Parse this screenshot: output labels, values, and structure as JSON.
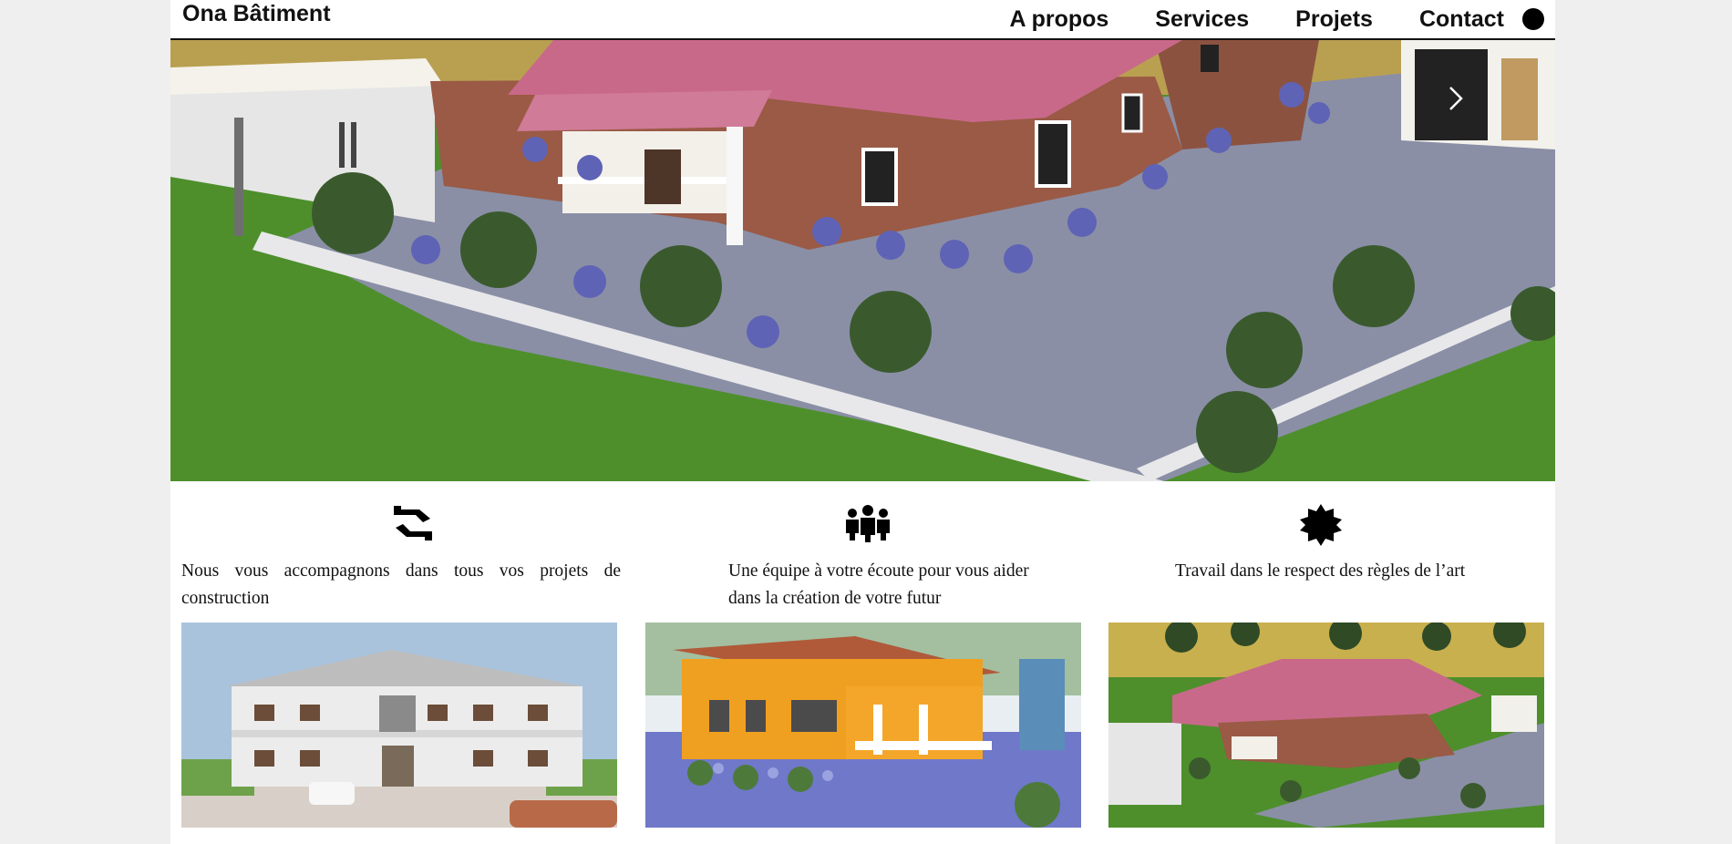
{
  "brand": "Ona Bâtiment",
  "nav": {
    "about": "A propos",
    "services": "Services",
    "projects": "Projets",
    "contact": "Contact"
  },
  "hero": {
    "image": "rendering of single-storey brick house with pink roof",
    "next_icon": "chevron-right-icon"
  },
  "features": [
    {
      "icon": "handshake-icon",
      "text": "Nous vous accompagnons dans tous vos projets de construction"
    },
    {
      "icon": "team-icon",
      "text": "Une équipe à votre écoute pour vous aider dans la création de votre futur"
    },
    {
      "icon": "badge-icon",
      "text": "Travail dans le respect des règles de l’art"
    }
  ],
  "gallery": [
    {
      "image": "two-storey white apartment building"
    },
    {
      "image": "orange single-storey house"
    },
    {
      "image": "brick house with pink roof, aerial view"
    }
  ],
  "colors": {
    "roof": "#c9698a",
    "brick": "#9a5a45",
    "grass": "#4e8f2c",
    "ink": "#111111"
  }
}
